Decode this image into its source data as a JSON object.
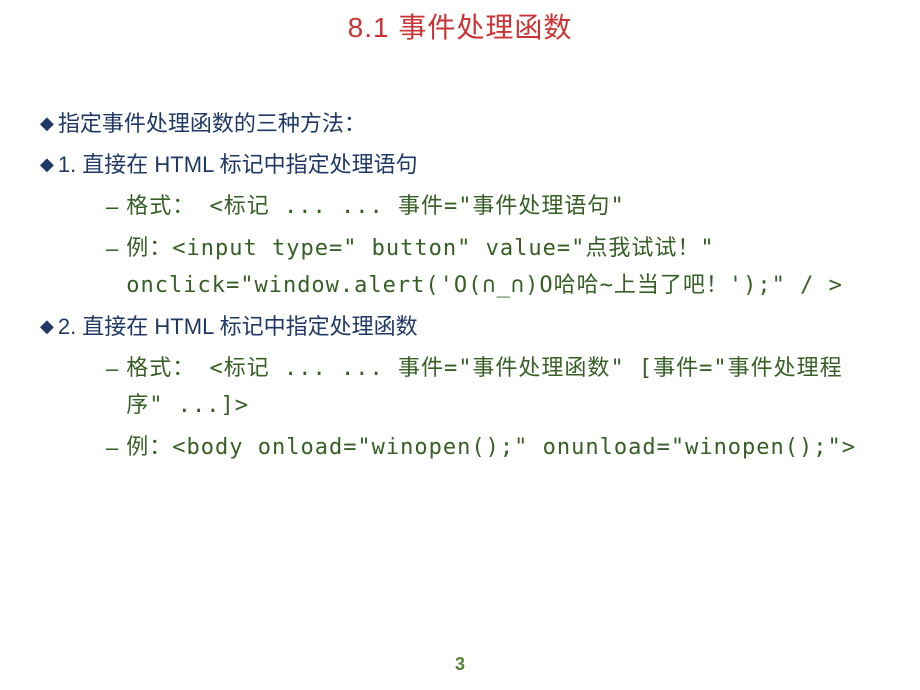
{
  "title": "8.1 事件处理函数",
  "bullets": {
    "intro": "指定事件处理函数的三种方法：",
    "item1": {
      "heading": "1.  直接在 HTML 标记中指定处理语句",
      "format": "格式： <标记 ... ...  事件=\"事件处理语句\"",
      "example": "例：<input type=\" button\"   value=\"点我试试！\" onclick=\"window.alert('O(∩_∩)O哈哈~上当了吧！');\" / >"
    },
    "item2": {
      "heading": "2.  直接在 HTML 标记中指定处理函数",
      "format": "格式： <标记 ... ...  事件=\"事件处理函数\" [事件=\"事件处理程序\" ...]>",
      "example": "例：<body onload=\"winopen();\" onunload=\"winopen();\">"
    }
  },
  "pageNumber": "3"
}
